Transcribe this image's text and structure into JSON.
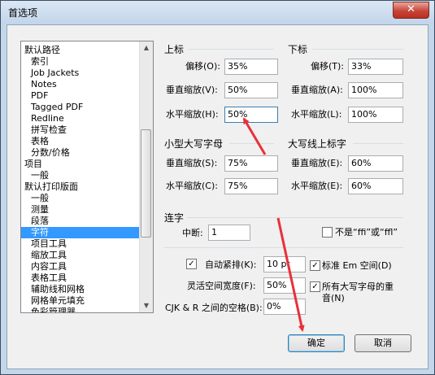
{
  "window": {
    "title": "首选项",
    "close_glyph": "✕"
  },
  "categories": [
    "默认路径",
    "索引",
    "Job Jackets",
    "Notes",
    "PDF",
    "Tagged PDF",
    "Redline",
    "拼写检查",
    "表格",
    "分数/价格",
    "项目",
    "一般",
    "默认打印版面",
    "一般",
    "测量",
    "段落",
    "字符",
    "项目工具",
    "缩放工具",
    "内容工具",
    "表格工具",
    "辅助线和网格",
    "网格单元填充",
    "色彩管理器"
  ],
  "selected_category": "字符",
  "superscript": {
    "title": "上标",
    "offset_label": "偏移(O):",
    "offset_value": "35%",
    "vscale_label": "垂直缩放(V):",
    "vscale_value": "50%",
    "hscale_label": "水平缩放(H):",
    "hscale_value": "50%"
  },
  "subscript": {
    "title": "下标",
    "offset_label": "偏移(T):",
    "offset_value": "33%",
    "vscale_label": "垂直缩放(A):",
    "vscale_value": "100%",
    "hscale_label": "水平缩放(L):",
    "hscale_value": "100%"
  },
  "small_caps": {
    "title": "小型大写字母",
    "vscale_label": "垂直缩放(S):",
    "vscale_value": "75%",
    "hscale_label": "水平缩放(C):",
    "hscale_value": "75%"
  },
  "superior": {
    "title": "大写线上标字",
    "vscale_label": "垂直缩放(E):",
    "vscale_value": "60%",
    "hscale_label": "水平缩放(E):",
    "hscale_value": "60%"
  },
  "ligatures": {
    "title": "连字",
    "break_label": "中断:",
    "break_value": "1",
    "not_ffi_label": "不是“ffi”或“ffl”",
    "not_ffi_checked": false
  },
  "kerning": {
    "auto_label": "自动紧排(K):",
    "auto_checked": true,
    "auto_check_glyph": "✓",
    "auto_value": "10 pt",
    "flex_label": "灵活空间宽度(F):",
    "flex_value": "50%",
    "cjk_label": "CJK & R 之间的空格(B):",
    "cjk_value": "0%"
  },
  "options": {
    "em_label": "标准 Em 空间(D)",
    "em_checked": true,
    "em_glyph": "✓",
    "caps_label_1": "所有大写字母的重",
    "caps_label_2": "音(N)",
    "caps_checked": true,
    "caps_glyph": "✓"
  },
  "buttons": {
    "ok": "确定",
    "cancel": "取消"
  },
  "annotation_color": "#e8303a"
}
